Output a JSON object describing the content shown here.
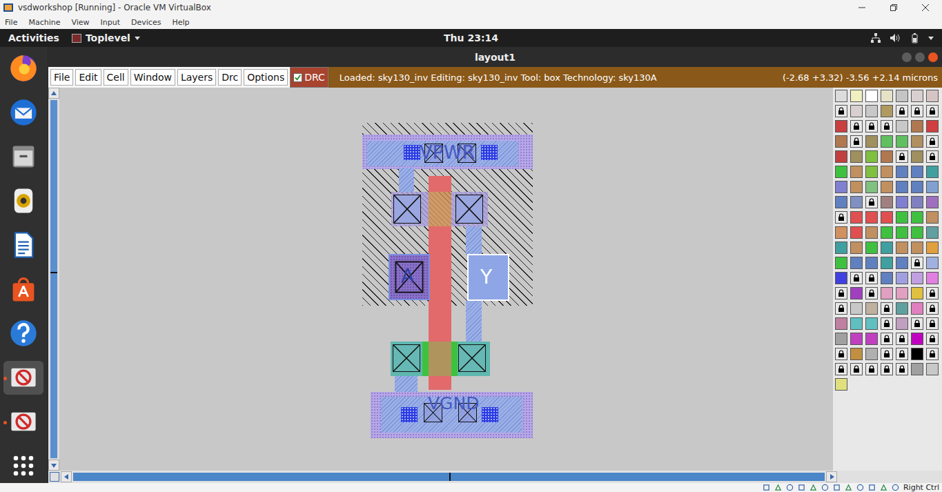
{
  "window": {
    "title": "vsdworkshop [Running] - Oracle VM VirtualBox"
  },
  "host_menu": [
    "File",
    "Machine",
    "View",
    "Input",
    "Devices",
    "Help"
  ],
  "topbar": {
    "activities": "Activities",
    "app": "Toplevel",
    "clock": "Thu 23:14"
  },
  "dock": [
    {
      "kind": "firefox",
      "running": false,
      "selected": false
    },
    {
      "kind": "mail",
      "running": false,
      "selected": false
    },
    {
      "kind": "files",
      "running": false,
      "selected": false
    },
    {
      "kind": "music",
      "running": false,
      "selected": false
    },
    {
      "kind": "writer",
      "running": false,
      "selected": false
    },
    {
      "kind": "store",
      "running": false,
      "selected": false
    },
    {
      "kind": "help",
      "running": false,
      "selected": false
    },
    {
      "kind": "blocked",
      "running": true,
      "selected": true
    },
    {
      "kind": "blocked",
      "running": true,
      "selected": false
    },
    {
      "kind": "grid",
      "running": false,
      "selected": false
    }
  ],
  "app_window": {
    "title": "layout1"
  },
  "magic_menu": [
    "File",
    "Edit",
    "Cell",
    "Window",
    "Layers",
    "Drc",
    "Options"
  ],
  "drc": {
    "label": "DRC",
    "checked": true
  },
  "status": {
    "text": "Loaded: sky130_inv Editing: sky130_inv Tool: box Technology: sky130A",
    "coords": "(-2.68 +3.32) -3.56 +2.14 microns"
  },
  "layout": {
    "power_label": "VPWR",
    "input_label": "A",
    "output_label": "Y",
    "ground_label": "VGND"
  },
  "palette": [
    [
      {
        "color": "#dcdcdc",
        "locked": false
      },
      {
        "color": "#f0f0c0",
        "locked": false
      },
      {
        "color": "#ffffff",
        "locked": false
      },
      {
        "color": "#e6e2c6",
        "locked": false
      },
      {
        "color": "#c4c4c4",
        "locked": false
      },
      {
        "color": "#d8d0d0",
        "locked": false
      },
      {
        "color": "#d6c4c4",
        "locked": false
      }
    ],
    [
      {
        "color": "#e8e8e8",
        "locked": true
      },
      {
        "color": "#d8d0d0",
        "locked": false
      },
      {
        "color": "#c8c8c8",
        "locked": false
      },
      {
        "color": "#b09a60",
        "locked": false
      },
      {
        "color": "#e8e8e8",
        "locked": true
      },
      {
        "color": "#e8e8e8",
        "locked": true
      },
      {
        "color": "#e8e8e8",
        "locked": true
      }
    ],
    [
      {
        "color": "#c84040",
        "locked": false
      },
      {
        "color": "#e8e8e8",
        "locked": true
      },
      {
        "color": "#e8e8e8",
        "locked": true
      },
      {
        "color": "#e8e8e8",
        "locked": true
      },
      {
        "color": "#c8c8c8",
        "locked": false
      },
      {
        "color": "#b07850",
        "locked": false
      },
      {
        "color": "#d04040",
        "locked": false
      }
    ],
    [
      {
        "color": "#b07850",
        "locked": false
      },
      {
        "color": "#e8e8e8",
        "locked": true
      },
      {
        "color": "#a09060",
        "locked": false
      },
      {
        "color": "#60c060",
        "locked": false
      },
      {
        "color": "#60c060",
        "locked": false
      },
      {
        "color": "#b09060",
        "locked": false
      },
      {
        "color": "#e8e8e8",
        "locked": true
      }
    ],
    [
      {
        "color": "#c04040",
        "locked": false
      },
      {
        "color": "#a09060",
        "locked": false
      },
      {
        "color": "#80c040",
        "locked": false
      },
      {
        "color": "#b07850",
        "locked": false
      },
      {
        "color": "#e8e8e8",
        "locked": true
      },
      {
        "color": "#a09060",
        "locked": false
      },
      {
        "color": "#e8e8e8",
        "locked": true
      }
    ],
    [
      {
        "color": "#40c040",
        "locked": false
      },
      {
        "color": "#c09060",
        "locked": false
      },
      {
        "color": "#80c040",
        "locked": false
      },
      {
        "color": "#c09060",
        "locked": false
      },
      {
        "color": "#6080c0",
        "locked": false
      },
      {
        "color": "#6080c0",
        "locked": false
      },
      {
        "color": "#40a0a0",
        "locked": false
      }
    ],
    [
      {
        "color": "#8080d0",
        "locked": false
      },
      {
        "color": "#c09060",
        "locked": false
      },
      {
        "color": "#80c080",
        "locked": false
      },
      {
        "color": "#c09060",
        "locked": false
      },
      {
        "color": "#6080c0",
        "locked": false
      },
      {
        "color": "#6080c0",
        "locked": false
      },
      {
        "color": "#80a0d0",
        "locked": false
      }
    ],
    [
      {
        "color": "#6080c0",
        "locked": false
      },
      {
        "color": "#8090c0",
        "locked": false
      },
      {
        "color": "#e8e8e8",
        "locked": true
      },
      {
        "color": "#a08080",
        "locked": false
      },
      {
        "color": "#8080d0",
        "locked": false
      },
      {
        "color": "#8080c0",
        "locked": false
      },
      {
        "color": "#a070c0",
        "locked": false
      }
    ],
    [
      {
        "color": "#e8e8e8",
        "locked": true
      },
      {
        "color": "#e05050",
        "locked": false
      },
      {
        "color": "#e05050",
        "locked": false
      },
      {
        "color": "#e05050",
        "locked": false
      },
      {
        "color": "#40c040",
        "locked": false
      },
      {
        "color": "#40c040",
        "locked": false
      },
      {
        "color": "#c09060",
        "locked": false
      }
    ],
    [
      {
        "color": "#d09060",
        "locked": false
      },
      {
        "color": "#e05050",
        "locked": false
      },
      {
        "color": "#c09060",
        "locked": false
      },
      {
        "color": "#40c040",
        "locked": false
      },
      {
        "color": "#40c040",
        "locked": false
      },
      {
        "color": "#40c040",
        "locked": false
      },
      {
        "color": "#60a0a0",
        "locked": false
      }
    ],
    [
      {
        "color": "#40a0a0",
        "locked": false
      },
      {
        "color": "#c09060",
        "locked": false
      },
      {
        "color": "#40c040",
        "locked": false
      },
      {
        "color": "#40a0a0",
        "locked": false
      },
      {
        "color": "#c09060",
        "locked": false
      },
      {
        "color": "#c09060",
        "locked": false
      },
      {
        "color": "#e0a040",
        "locked": false
      }
    ],
    [
      {
        "color": "#40c040",
        "locked": false
      },
      {
        "color": "#6080c0",
        "locked": false
      },
      {
        "color": "#6080c0",
        "locked": false
      },
      {
        "color": "#40a0a0",
        "locked": false
      },
      {
        "color": "#6080c0",
        "locked": false
      },
      {
        "color": "#e8e8e8",
        "locked": true
      },
      {
        "color": "#a0b0e0",
        "locked": false
      }
    ],
    [
      {
        "color": "#4040e0",
        "locked": false
      },
      {
        "color": "#e8e8e8",
        "locked": true
      },
      {
        "color": "#e8e8e8",
        "locked": true
      },
      {
        "color": "#6080c0",
        "locked": false
      },
      {
        "color": "#a0a0e0",
        "locked": false
      },
      {
        "color": "#c0a0e0",
        "locked": false
      },
      {
        "color": "#e080e0",
        "locked": false
      }
    ],
    [
      {
        "color": "#e8e8e8",
        "locked": true
      },
      {
        "color": "#a040c0",
        "locked": false
      },
      {
        "color": "#e8e8e8",
        "locked": true
      },
      {
        "color": "#e0a0c0",
        "locked": false
      },
      {
        "color": "#e0a0c0",
        "locked": false
      },
      {
        "color": "#e0c040",
        "locked": false
      },
      {
        "color": "#e8e8e8",
        "locked": true
      }
    ],
    [
      {
        "color": "#e8e8e8",
        "locked": true
      },
      {
        "color": "#c8c8c8",
        "locked": false
      },
      {
        "color": "#c0b0a0",
        "locked": false
      },
      {
        "color": "#e8e8e8",
        "locked": true
      },
      {
        "color": "#60a0a0",
        "locked": false
      },
      {
        "color": "#e080c0",
        "locked": false
      },
      {
        "color": "#e8e8e8",
        "locked": true
      }
    ],
    [
      {
        "color": "#c080a0",
        "locked": false
      },
      {
        "color": "#60c0c0",
        "locked": false
      },
      {
        "color": "#60c0c0",
        "locked": false
      },
      {
        "color": "#e8e8e8",
        "locked": true
      },
      {
        "color": "#c0a0c0",
        "locked": false
      },
      {
        "color": "#e8e8e8",
        "locked": true
      },
      {
        "color": "#e8e8e8",
        "locked": true
      }
    ],
    [
      {
        "color": "#a0a0a0",
        "locked": false
      },
      {
        "color": "#c040c0",
        "locked": false
      },
      {
        "color": "#c040c0",
        "locked": false
      },
      {
        "color": "#e8e8e8",
        "locked": true
      },
      {
        "color": "#e8e8e8",
        "locked": true
      },
      {
        "color": "#c000c0",
        "locked": false
      },
      {
        "color": "#e8e8e8",
        "locked": true
      }
    ],
    [
      {
        "color": "#e8e8e8",
        "locked": true
      },
      {
        "color": "#c09040",
        "locked": false
      },
      {
        "color": "#b0b0b0",
        "locked": false
      },
      {
        "color": "#e8e8e8",
        "locked": true
      },
      {
        "color": "#e8e8e8",
        "locked": true
      },
      {
        "color": "#000000",
        "locked": false
      },
      {
        "color": "#e8e8e8",
        "locked": true
      }
    ],
    [
      {
        "color": "#e8e8e8",
        "locked": true
      },
      {
        "color": "#e8e8e8",
        "locked": true
      },
      {
        "color": "#e8e8e8",
        "locked": true
      },
      {
        "color": "#e8e8e8",
        "locked": true
      },
      {
        "color": "#e8e8e8",
        "locked": true
      },
      {
        "color": "#a0a0a0",
        "locked": false
      },
      {
        "color": "#c8c8c8",
        "locked": false
      }
    ],
    [
      {
        "color": "#e0e080",
        "locked": false
      }
    ]
  ],
  "statusbar": {
    "host_key": "Right Ctrl"
  }
}
